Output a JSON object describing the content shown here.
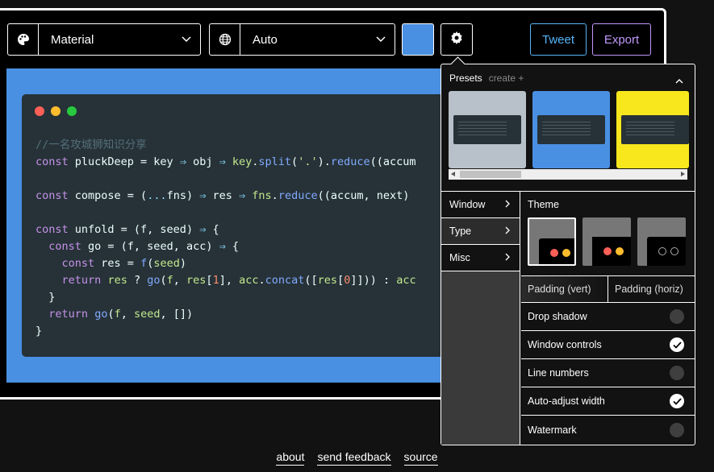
{
  "toolbar": {
    "theme_select": {
      "value": "Material"
    },
    "language_select": {
      "value": "Auto"
    },
    "background_color": "#4a90e2",
    "tweet_label": "Tweet",
    "export_label": "Export",
    "tweet_color": "#57b5f9",
    "export_color": "#c198fb"
  },
  "code": {
    "window_dots": [
      "#ff5f56",
      "#ffbd2e",
      "#27c93f"
    ],
    "lines": [
      "//一名攻城狮知识分享",
      "const pluckDeep = key ⇒ obj ⇒ key.split('.').reduce((accum",
      "",
      "const compose = (...fns) ⇒ res ⇒ fns.reduce((accum, next)",
      "",
      "const unfold = (f, seed) ⇒ {",
      "  const go = (f, seed, acc) ⇒ {",
      "    const res = f(seed)",
      "    return res ? go(f, res[1], acc.concat([res[0]])) : acc",
      "  }",
      "  return go(f, seed, [])",
      "}"
    ]
  },
  "settings": {
    "presets_title": "Presets",
    "presets_create": "create +",
    "preset_backgrounds": [
      "#b8c1c9",
      "#4a90e2",
      "#f8e71c"
    ],
    "menu": [
      "Window",
      "Type",
      "Misc"
    ],
    "theme_title": "Theme",
    "padding_vert": "Padding (vert)",
    "padding_horiz": "Padding (horiz)",
    "toggles": [
      {
        "label": "Drop shadow",
        "on": false
      },
      {
        "label": "Window controls",
        "on": true
      },
      {
        "label": "Line numbers",
        "on": false
      },
      {
        "label": "Auto-adjust width",
        "on": true
      },
      {
        "label": "Watermark",
        "on": false
      }
    ]
  },
  "footer": {
    "links": [
      "about",
      "send feedback",
      "source"
    ]
  }
}
